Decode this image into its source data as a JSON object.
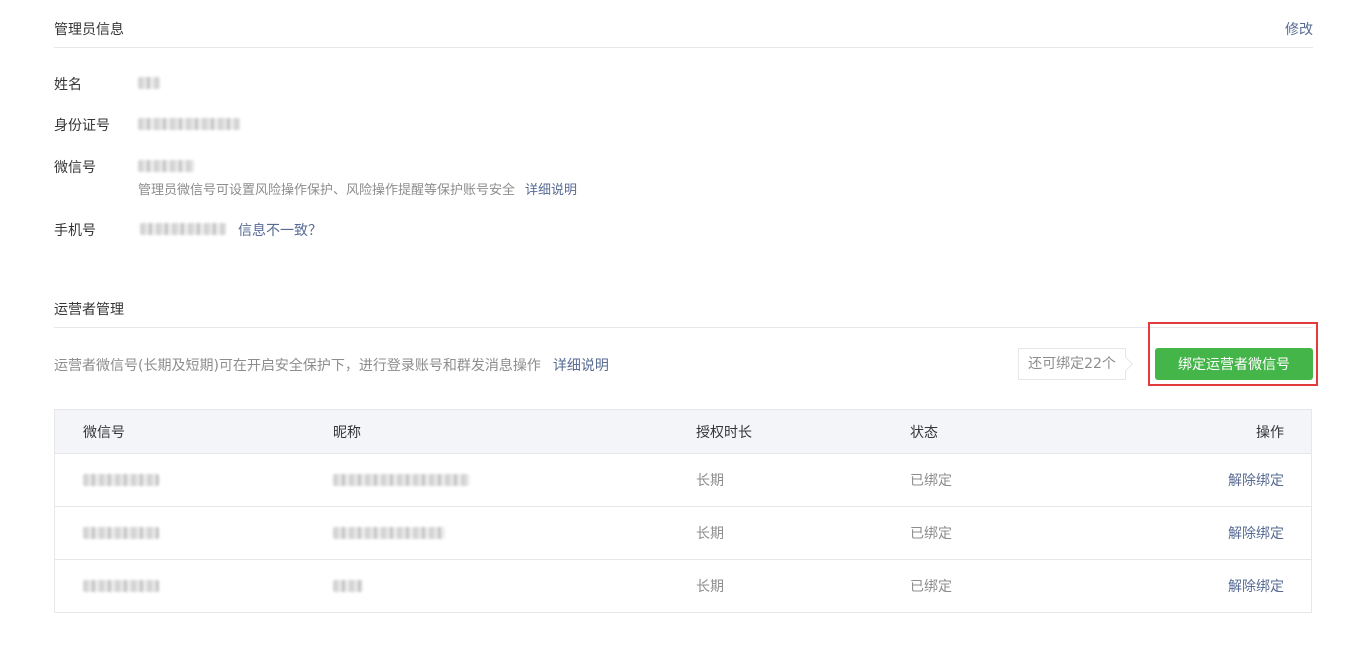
{
  "admin_info": {
    "title": "管理员信息",
    "edit_label": "修改",
    "fields": {
      "name_label": "姓名",
      "id_label": "身份证号",
      "wechat_label": "微信号",
      "wechat_tip": "管理员微信号可设置风险操作保护、风险操作提醒等保护账号安全",
      "wechat_tip_link": "详细说明",
      "phone_label": "手机号",
      "phone_link": "信息不一致？"
    }
  },
  "operator": {
    "title": "运营者管理",
    "description": "运营者微信号(长期及短期)可在开启安全保护下，进行登录账号和群发消息操作",
    "description_link": "详细说明",
    "quota_label": "还可绑定22个",
    "bind_button": "绑定运营者微信号",
    "highlight_color": "#e23b3b",
    "button_color": "#44b549",
    "table": {
      "headers": [
        "微信号",
        "昵称",
        "授权时长",
        "状态",
        "操作"
      ],
      "rows": [
        {
          "duration": "长期",
          "status": "已绑定",
          "action": "解除绑定"
        },
        {
          "duration": "长期",
          "status": "已绑定",
          "action": "解除绑定"
        },
        {
          "duration": "长期",
          "status": "已绑定",
          "action": "解除绑定"
        }
      ]
    }
  }
}
